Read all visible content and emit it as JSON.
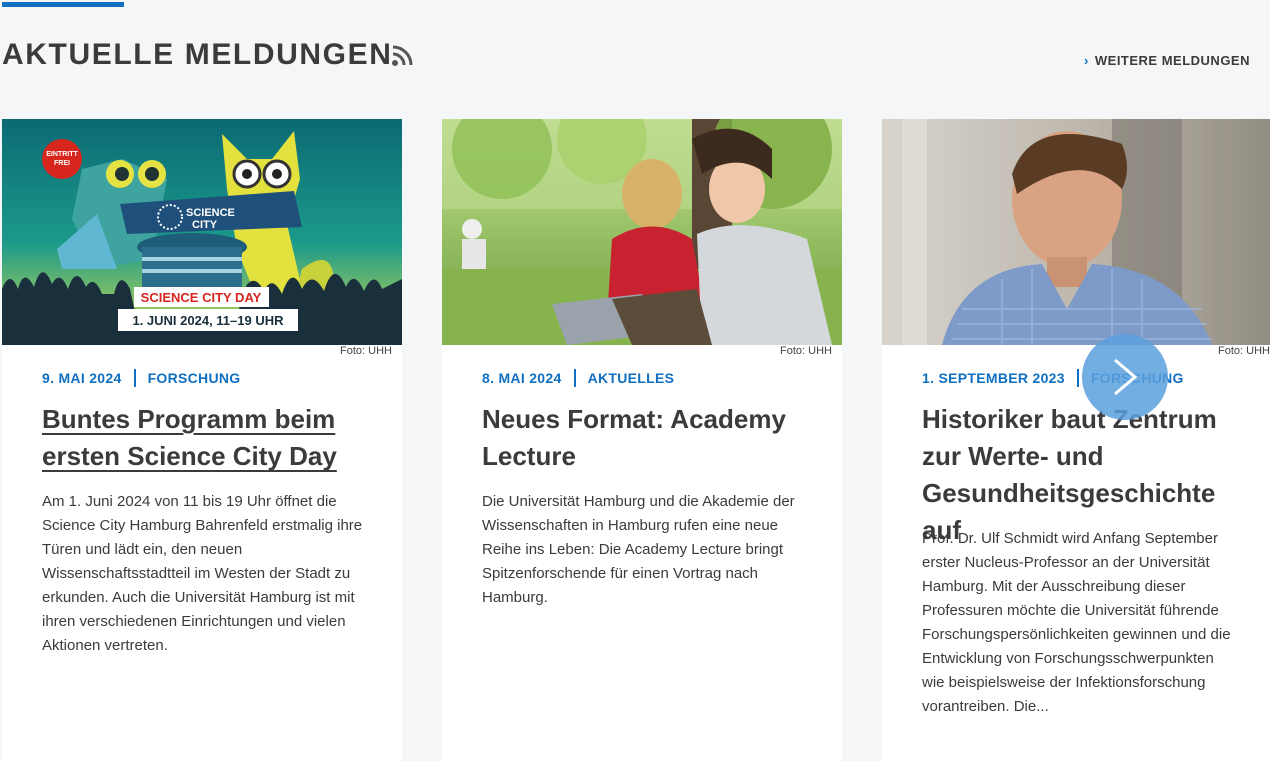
{
  "section": {
    "title": "AKTUELLE MELDUNGEN",
    "more_link": "WEITERE MELDUNGEN",
    "accent_color": "#0f6fc1"
  },
  "cards": [
    {
      "credit": "Foto: UHH",
      "date": "9. MAI 2024",
      "category": "FORSCHUNG",
      "title": "Buntes Programm beim ersten Science City Day",
      "excerpt": "Am 1. Juni 2024 von 11 bis 19 Uhr öffnet die Science City Hamburg Bahrenfeld erstmalig ihre Türen und lädt ein, den neuen Wissenschaftsstadtteil im Westen der Stadt zu erkunden. Auch die Universität Hamburg ist mit ihren verschiedenen Einrichtungen und vielen Aktionen vertreten.",
      "image": {
        "badge": "EINTRITT FREI",
        "logo_line1": "SCIENCE",
        "logo_line2": "CITY",
        "banner": "SCIENCE CITY DAY",
        "date_banner": "1. JUNI 2024, 11–19 UHR"
      }
    },
    {
      "credit": "Foto: UHH",
      "date": "8. MAI 2024",
      "category": "AKTUELLES",
      "title": "Neues Format: Academy Lecture",
      "excerpt": "Die Universität Hamburg und die Akademie der Wissenschaften in Hamburg rufen eine neue Reihe ins Leben: Die Academy Lecture bringt Spitzenforschende für einen Vortrag nach Hamburg."
    },
    {
      "credit": "Foto: UHH",
      "date": "1. SEPTEMBER 2023",
      "category": "FORSCHUNG",
      "title": "Historiker baut Zentrum zur Werte- und Gesundheitsgeschichte auf",
      "excerpt": "Prof. Dr. Ulf Schmidt wird Anfang September erster Nucleus-Professor an der Universität Hamburg. Mit der Ausschreibung dieser Professuren möchte die Universität führende Forschungspersönlichkeiten gewinnen und die Entwicklung von Forschungsschwerpunkten wie beispielsweise der Infektionsforschung vorantreiben. Die..."
    }
  ],
  "icons": {
    "rss": "rss-icon",
    "next": "chevron-right-icon",
    "more": "chevron-right-icon"
  }
}
